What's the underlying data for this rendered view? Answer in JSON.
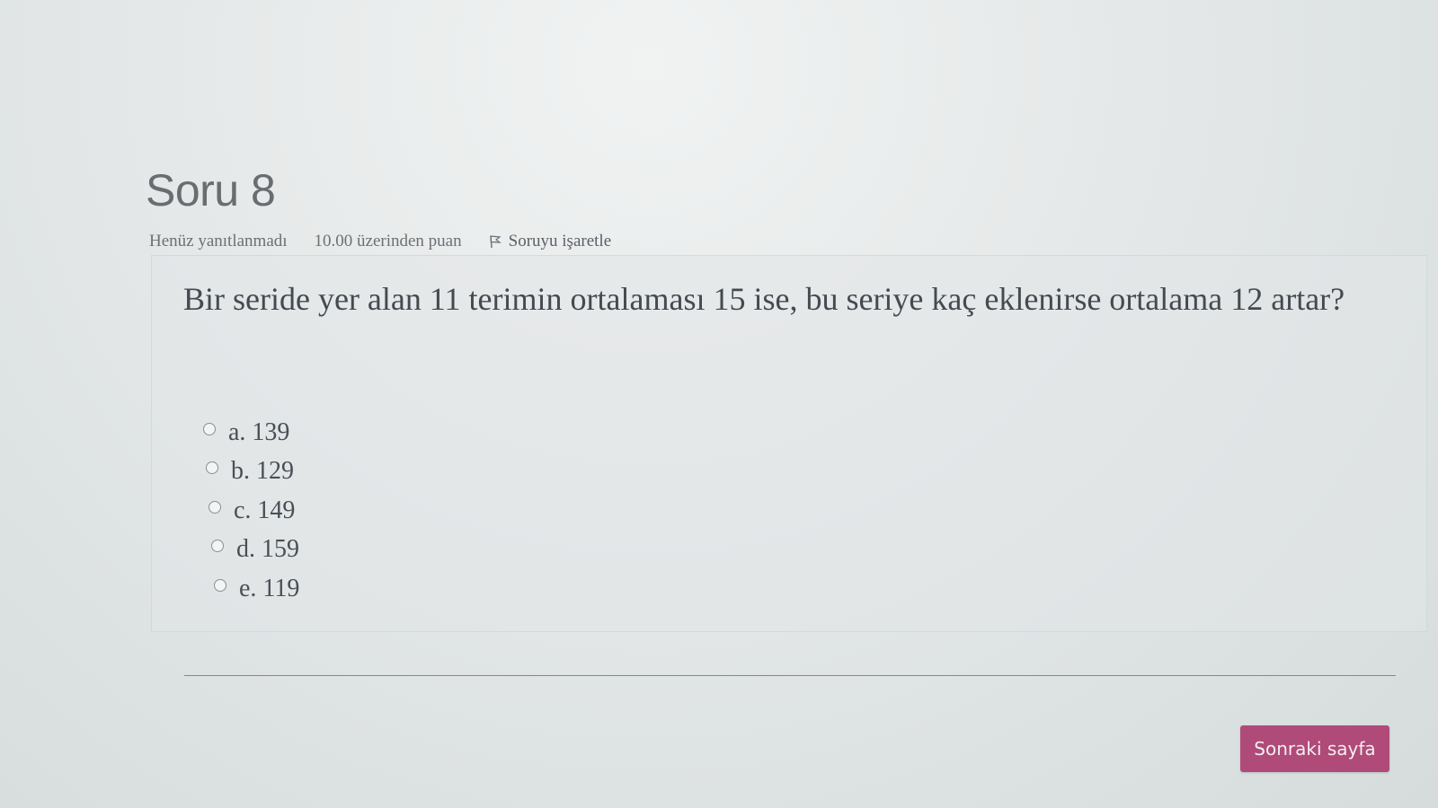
{
  "question": {
    "title": "Soru 8",
    "status": "Henüz yanıtlanmadı",
    "points": "10.00 üzerinden puan",
    "flag_label": "Soruyu işaretle",
    "text": "Bir seride yer alan 11 terimin ortalaması 15 ise, bu seriye kaç eklenirse ortalama 12 artar?",
    "answers": [
      {
        "label": "a. 139"
      },
      {
        "label": "b. 129"
      },
      {
        "label": "c. 149"
      },
      {
        "label": "d. 159"
      },
      {
        "label": "e. 119"
      }
    ]
  },
  "navigation": {
    "next_label": "Sonraki sayfa"
  },
  "colors": {
    "accent": "#b04a79",
    "divider": "#b86e86"
  },
  "icons": {
    "flag": "flag-icon",
    "radio": "radio-icon"
  }
}
